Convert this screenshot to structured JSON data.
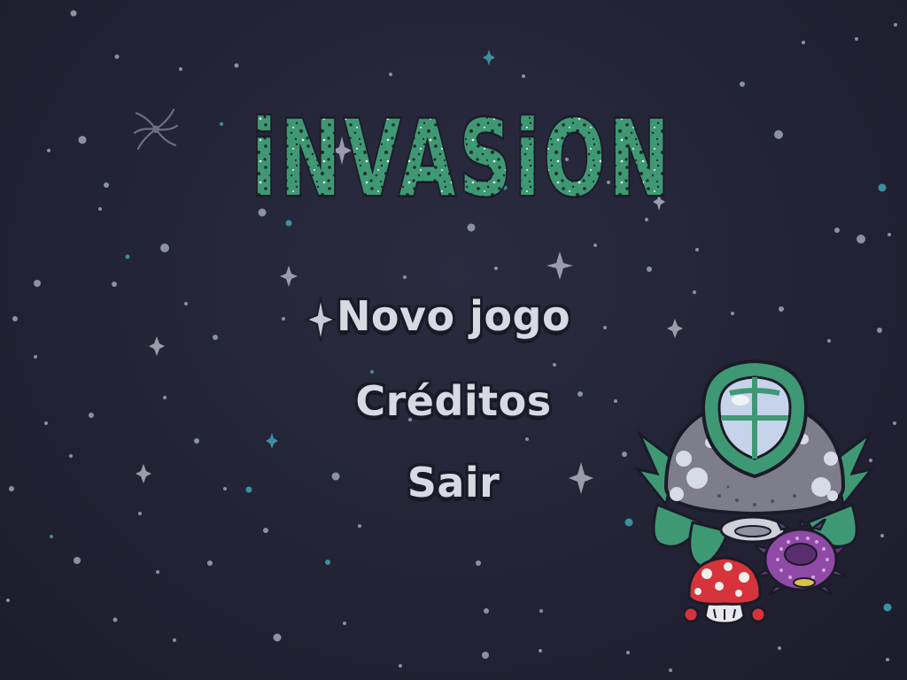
{
  "game": {
    "title": "iNVASiON"
  },
  "menu": {
    "items": [
      {
        "label": "Novo jogo",
        "selected": true
      },
      {
        "label": "Créditos",
        "selected": false
      },
      {
        "label": "Sair",
        "selected": false
      }
    ]
  },
  "theme": {
    "background": "#232336",
    "title_green": "#3f9874",
    "menu_text": "#d9d9e4",
    "outline": "#1b1b28"
  },
  "sprites": {
    "ship": "alien-ufo-ship",
    "enemy_1": "red-mushroom-creature",
    "enemy_2": "purple-spiky-urchin-creature",
    "selector": "four-point-star-icon"
  }
}
